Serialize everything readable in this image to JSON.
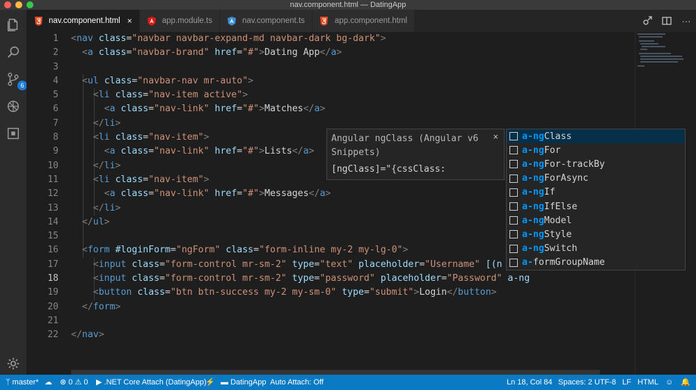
{
  "window": {
    "title": "nav.component.html — DatingApp"
  },
  "activity": {
    "scm_badge": "6"
  },
  "tabs": [
    {
      "label": "nav.component.html",
      "icon": "html5-icon",
      "active": true,
      "close": "×"
    },
    {
      "label": "app.module.ts",
      "icon": "angular-icon",
      "active": false
    },
    {
      "label": "nav.component.ts",
      "icon": "angular-icon",
      "active": false
    },
    {
      "label": "app.component.html",
      "icon": "html5-icon",
      "active": false
    }
  ],
  "editor": {
    "line_numbers": [
      "1",
      "2",
      "3",
      "4",
      "5",
      "6",
      "7",
      "8",
      "9",
      "10",
      "11",
      "12",
      "13",
      "14",
      "15",
      "16",
      "17",
      "18",
      "19",
      "20",
      "21",
      "22"
    ],
    "current_line": "18",
    "lines": [
      "<nav class=\"navbar navbar-expand-md navbar-dark bg-dark\">",
      "  <a class=\"navbar-brand\" href=\"#\">Dating App</a>",
      "",
      "  <ul class=\"navbar-nav mr-auto\">",
      "    <li class=\"nav-item active\">",
      "      <a class=\"nav-link\" href=\"#\">Matches</a>",
      "    </li>",
      "    <li class=\"nav-item\">",
      "      <a class=\"nav-link\" href=\"#\">Lists</a>",
      "    </li>",
      "    <li class=\"nav-item\">",
      "      <a class=\"nav-link\" href=\"#\">Messages</a>",
      "    </li>",
      "  </ul>",
      "",
      "  <form #loginForm=\"ngForm\" class=\"form-inline my-2 my-lg-0\">",
      "    <input class=\"form-control mr-sm-2\" type=\"text\" placeholder=\"Username\" [(n",
      "    <input class=\"form-control mr-sm-2\" type=\"password\" placeholder=\"Password\" a-ng",
      "    <button class=\"btn btn-success my-2 my-sm-0\" type=\"submit\">Login</button>",
      "  </form>",
      "",
      "</nav>"
    ]
  },
  "detail": {
    "title": "Angular ngClass (Angular v6 Snippets)",
    "close": "×",
    "body": "[ngClass]=\"{cssClass:"
  },
  "suggestions": [
    {
      "match": "a-ng",
      "rest": "Class",
      "selected": true
    },
    {
      "match": "a-ng",
      "rest": "For",
      "selected": false
    },
    {
      "match": "a-ng",
      "rest": "For-trackBy",
      "selected": false
    },
    {
      "match": "a-ng",
      "rest": "ForAsync",
      "selected": false
    },
    {
      "match": "a-ng",
      "rest": "If",
      "selected": false
    },
    {
      "match": "a-ng",
      "rest": "IfElse",
      "selected": false
    },
    {
      "match": "a-ng",
      "rest": "Model",
      "selected": false
    },
    {
      "match": "a-ng",
      "rest": "Style",
      "selected": false
    },
    {
      "match": "a-ng",
      "rest": "Switch",
      "selected": false
    },
    {
      "match": "a-",
      "rest": "formGroupName",
      "selected": false
    }
  ],
  "statusbar": {
    "branch": "master*",
    "errors": "0",
    "warnings": "0",
    "debug": ".NET Core Attach (DatingApp)",
    "folder": "DatingApp",
    "auto_attach": "Auto Attach: Off",
    "position": "Ln 18, Col 84",
    "spaces": "Spaces: 2",
    "encoding": "UTF-8",
    "eol": "LF",
    "language": "HTML"
  },
  "colors": {
    "tag": "#569cd6",
    "attribute": "#9cdcfe",
    "string": "#ce9178",
    "statusbar": "#0b7ac5",
    "match_highlight": "#0097fb"
  }
}
